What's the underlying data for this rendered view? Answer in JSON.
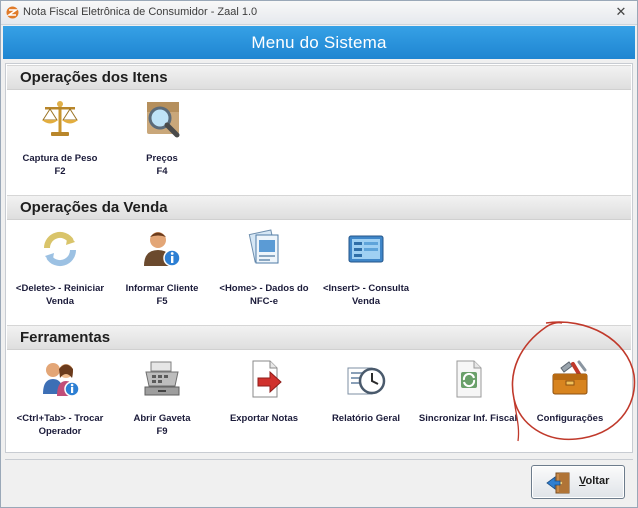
{
  "window": {
    "title": "Nota Fiscal Eletrônica de Consumidor - Zaal 1.0",
    "close_glyph": "✕"
  },
  "banner": {
    "heading": "Menu do Sistema",
    "color": "#2b93dc"
  },
  "sections": [
    {
      "title": "Operações dos Itens",
      "items": [
        {
          "label": "Captura de Peso\nF2",
          "icon": "scale-icon"
        },
        {
          "label": "Preços\nF4",
          "icon": "price-search-icon"
        }
      ]
    },
    {
      "title": "Operações da Venda",
      "items": [
        {
          "label": "<Delete> - Reiniciar\nVenda",
          "icon": "refresh-icon"
        },
        {
          "label": "Informar Cliente\nF5",
          "icon": "customer-info-icon"
        },
        {
          "label": "<Home> - Dados do\nNFC-e",
          "icon": "invoice-data-icon"
        },
        {
          "label": "<Insert> - Consulta\nVenda",
          "icon": "sales-query-icon"
        }
      ]
    },
    {
      "title": "Ferramentas",
      "items": [
        {
          "label": "<Ctrl+Tab> - Trocar\nOperador",
          "icon": "switch-operator-icon"
        },
        {
          "label": "Abrir Gaveta\nF9",
          "icon": "cash-register-icon"
        },
        {
          "label": "Exportar Notas",
          "icon": "export-document-icon"
        },
        {
          "label": "Relatório Geral",
          "icon": "report-clock-icon"
        },
        {
          "label": "Sincronizar Inf. Fiscal",
          "icon": "sync-document-icon"
        },
        {
          "label": "Configurações",
          "icon": "toolbox-icon"
        }
      ]
    }
  ],
  "footer": {
    "back_label": "Voltar",
    "back_icon": "exit-door-icon"
  },
  "annotation": {
    "color": "#c0392b"
  }
}
